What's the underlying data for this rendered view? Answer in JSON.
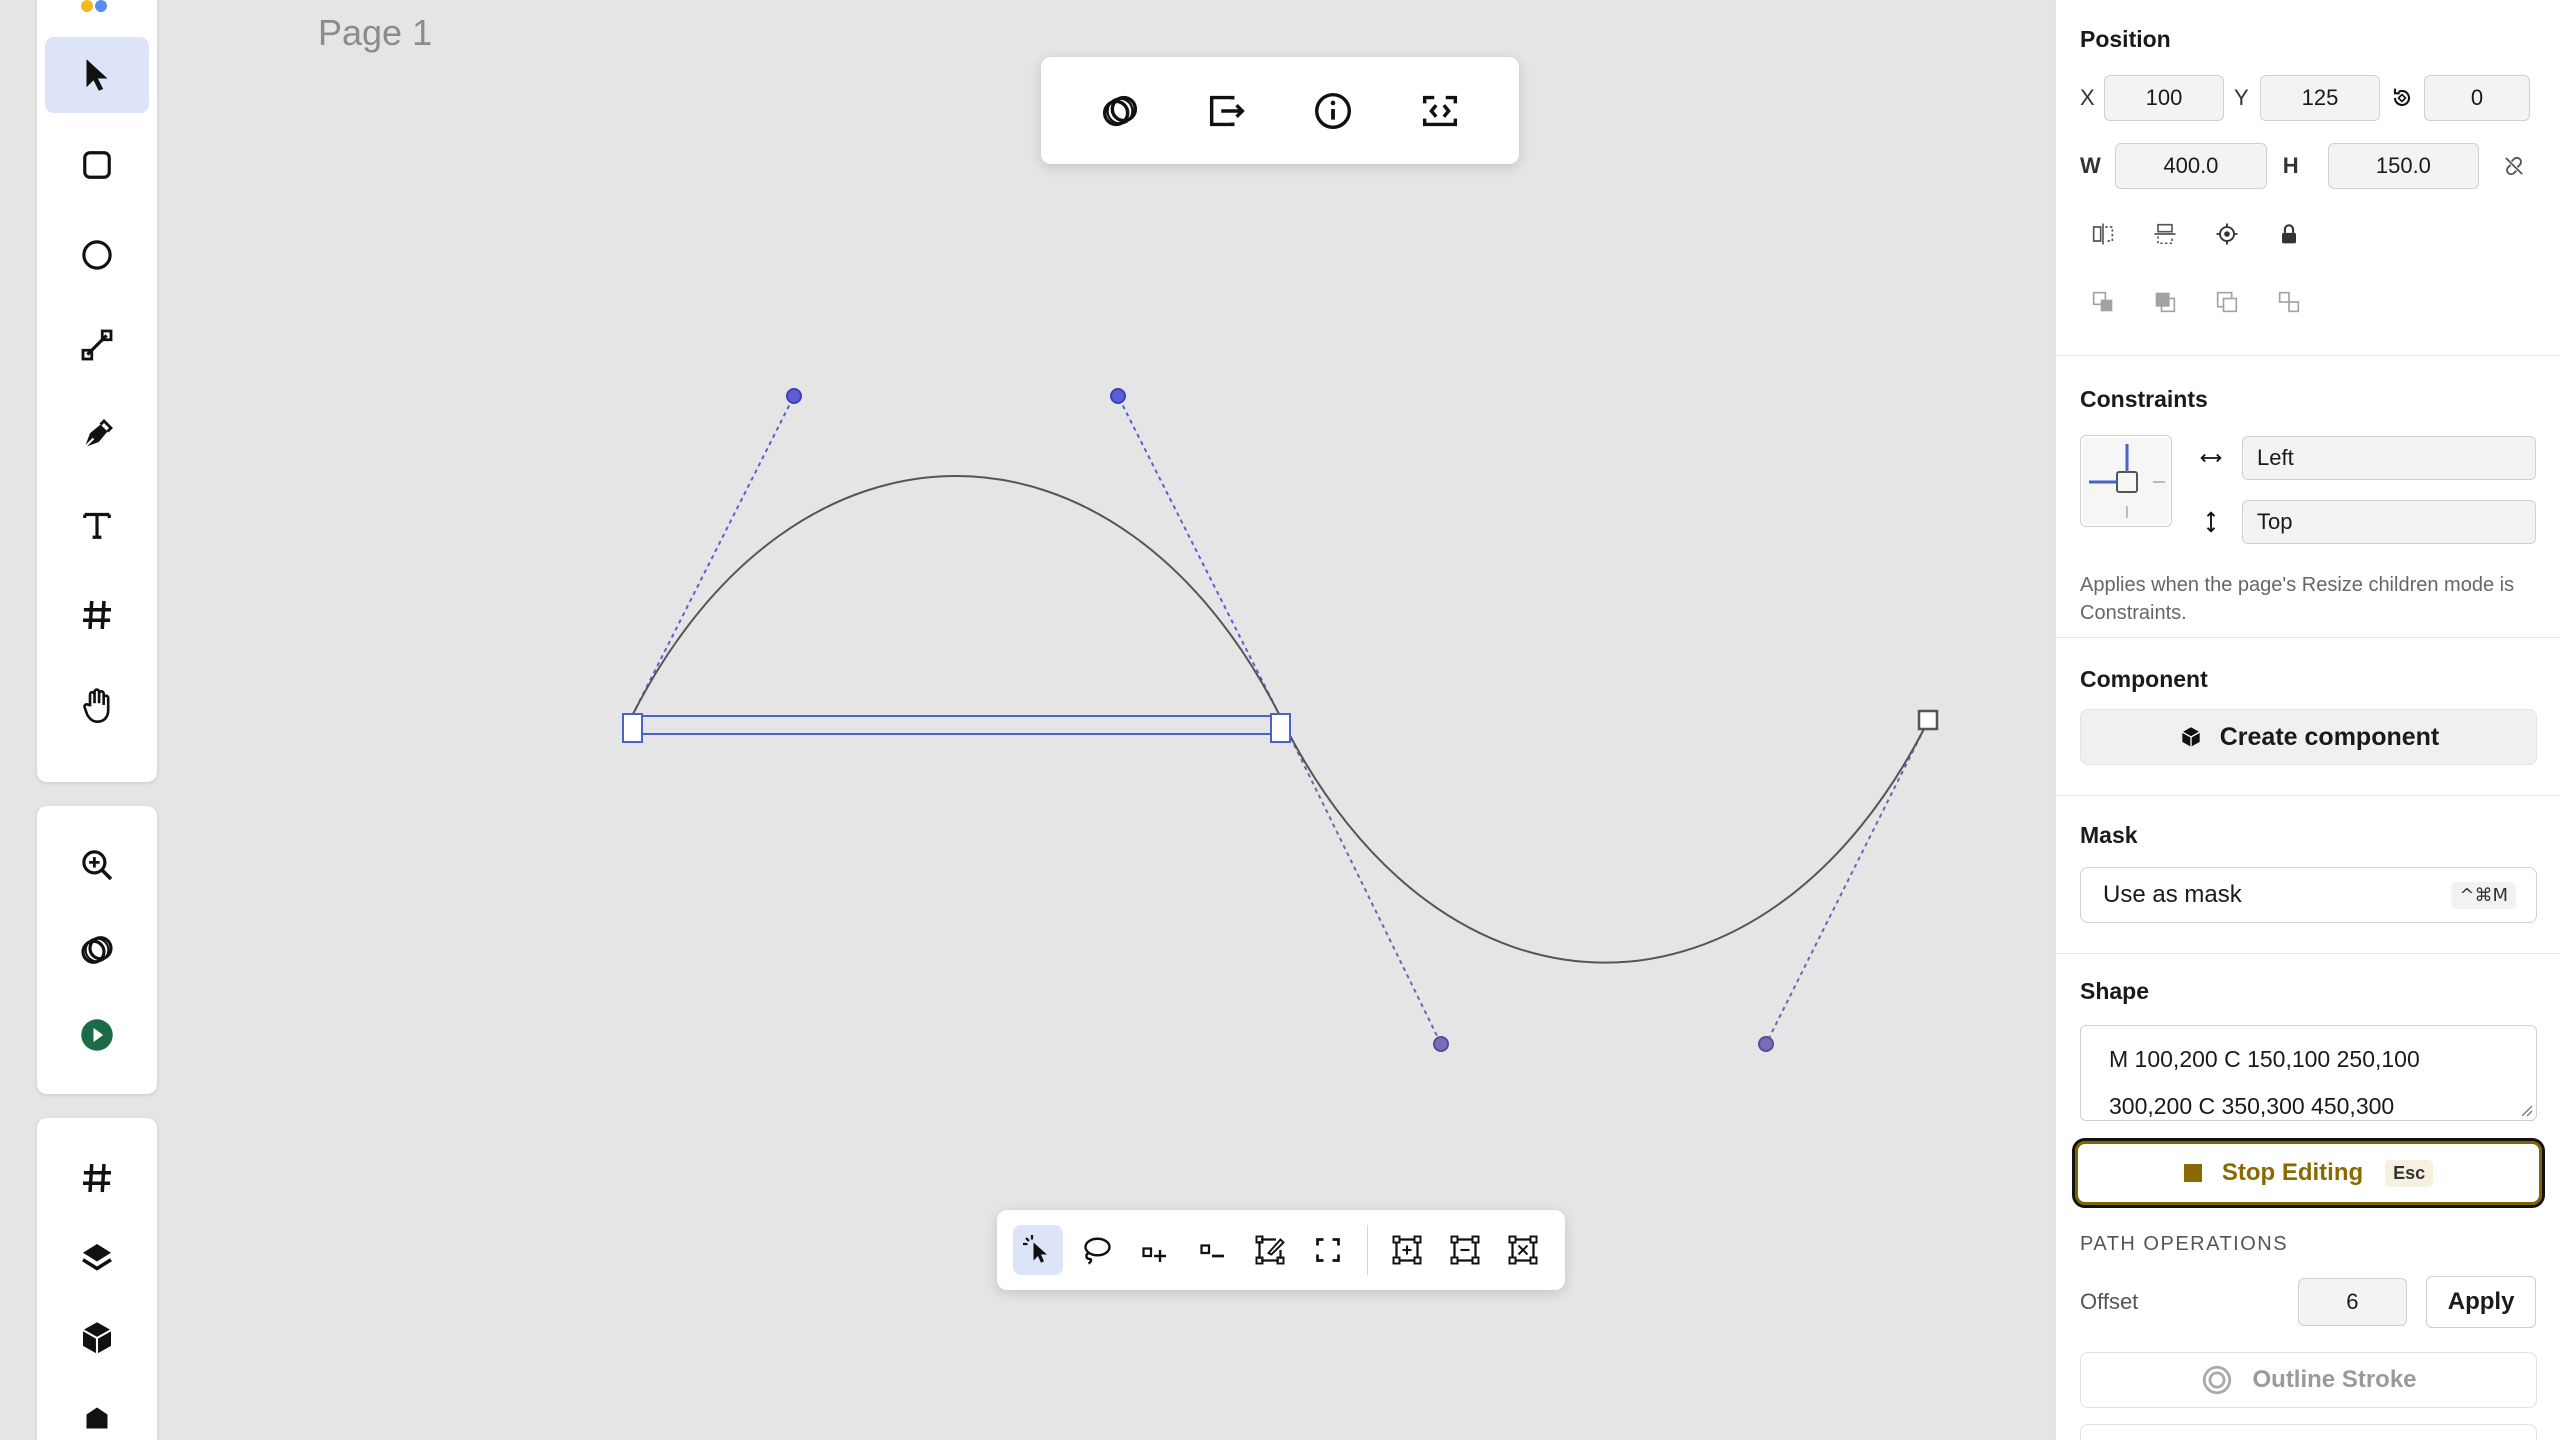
{
  "canvas": {
    "page_label": "Page 1"
  },
  "left_toolbar": {
    "tools": [
      {
        "name": "select-tool",
        "icon": "cursor-arrow-icon",
        "active": true
      },
      {
        "name": "rectangle-tool",
        "icon": "rounded-square-icon"
      },
      {
        "name": "ellipse-tool",
        "icon": "circle-icon"
      },
      {
        "name": "line-tool",
        "icon": "line-icon"
      },
      {
        "name": "pen-tool",
        "icon": "pen-nib-icon"
      },
      {
        "name": "text-tool",
        "icon": "text-t-icon"
      },
      {
        "name": "frame-tool",
        "icon": "hash-icon"
      },
      {
        "name": "hand-tool",
        "icon": "hand-icon"
      }
    ],
    "group2": [
      "zoom-in-icon",
      "boolean-ops-icon",
      "play-icon"
    ],
    "group3": [
      "hash-icon",
      "layers-icon",
      "component-icon"
    ]
  },
  "top_float_bar": [
    "boolean-ops-icon",
    "export-icon",
    "info-icon",
    "code-icon"
  ],
  "bottom_path_bar": {
    "tools": [
      "select-points-icon",
      "lasso-icon",
      "add-point-icon",
      "remove-point-icon",
      "edit-segment-icon",
      "close-path-icon",
      "align-points-icon",
      "distribute-points-icon",
      "transform-points-icon"
    ]
  },
  "panel": {
    "position": {
      "title": "Position",
      "x_label": "X",
      "x_value": "100",
      "y_label": "Y",
      "y_value": "125",
      "rotation_value": "0",
      "w_label": "W",
      "w_value": "400.0",
      "h_label": "H",
      "h_value": "150.0"
    },
    "constraints": {
      "title": "Constraints",
      "horizontal": "Left",
      "vertical": "Top",
      "help": "Applies when the page's Resize children mode is Constraints."
    },
    "component": {
      "title": "Component",
      "button": "Create component"
    },
    "mask": {
      "title": "Mask",
      "button": "Use as mask",
      "shortcut": "^⌘M"
    },
    "shape": {
      "title": "Shape",
      "path_line1": "M 100,200 C 150,100 250,100",
      "path_line2": "300,200 C 350,300 450,300",
      "stop_label": "Stop Editing",
      "stop_shortcut": "Esc",
      "ops_title": "PATH OPERATIONS",
      "offset_label": "Offset",
      "offset_value": "6",
      "apply_label": "Apply",
      "outline_label": "Outline Stroke"
    }
  },
  "colors": {
    "accent": "#4a63c9",
    "handle": "#5b5fd6",
    "stop_editing": "#8a6a00",
    "play": "#1b6b47"
  }
}
